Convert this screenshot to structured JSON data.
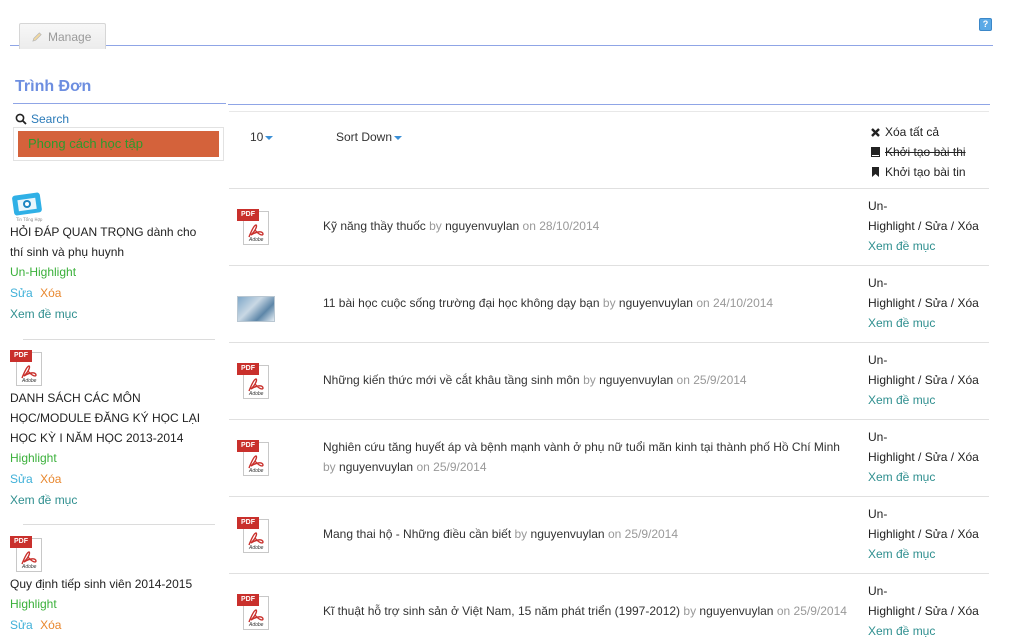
{
  "topbar": {
    "manage_label": "Manage",
    "help_label": "?"
  },
  "sidebar": {
    "title": "Trình Đơn",
    "search_label": "Search",
    "search_value": "Phong cách học tập",
    "items": [
      {
        "title": "HỎI ĐÁP QUAN TRỌNG dành cho thí sinh và phụ huynh",
        "highlight": "Un-Highlight",
        "edit": "Sửa",
        "delete": "Xóa",
        "view": "Xem đề mục",
        "icon": "tv-icon"
      },
      {
        "title": "DANH SÁCH CÁC MÔN HỌC/MODULE ĐĂNG KÝ HỌC LẠI HỌC KỲ I NĂM HỌC 2013-2014",
        "highlight": "Highlight",
        "edit": "Sửa",
        "delete": "Xóa",
        "view": "Xem đề mục",
        "icon": "pdf-icon"
      },
      {
        "title": "Quy định tiếp sinh viên 2014-2015",
        "highlight": "Highlight",
        "edit": "Sửa",
        "delete": "Xóa",
        "icon": "pdf-icon"
      }
    ]
  },
  "toolbar": {
    "page_size": "10",
    "sort": "Sort Down",
    "delete_all": "Xóa tất cả",
    "create_exam": "Khởi tạo bài thi",
    "create_news": "Khởi tạo bài tin"
  },
  "rows": [
    {
      "title": "Kỹ năng thầy thuốc",
      "by": "by",
      "author": "nguyenvuylan",
      "on": "on",
      "date": "28/10/2014",
      "icon": "pdf-icon"
    },
    {
      "title": "11 bài học cuộc sống trường đại học không dạy bạn",
      "by": "by",
      "author": "nguyenvuylan",
      "on": "on",
      "date": "24/10/2014",
      "icon": "photo"
    },
    {
      "title": "Những kiến thức mới về cắt khâu tầng sinh môn",
      "by": "by",
      "author": "nguyenvuylan",
      "on": "on",
      "date": "25/9/2014",
      "icon": "pdf-icon"
    },
    {
      "title": "Nghiên cứu tăng huyết áp và bệnh mạnh vành ở phụ nữ tuổi mãn kinh tại thành phố Hồ Chí Minh",
      "by": "by",
      "author": "nguyenvuylan",
      "on": "on",
      "date": "25/9/2014",
      "icon": "pdf-icon"
    },
    {
      "title": "Mang thai hộ - Những điều cần biết",
      "by": "by",
      "author": "nguyenvuylan",
      "on": "on",
      "date": "25/9/2014",
      "icon": "pdf-icon"
    },
    {
      "title": "Kĩ thuật hỗ trợ sinh sản ở Việt Nam, 15 năm phát triển (1997-2012)",
      "by": "by",
      "author": "nguyenvuylan",
      "on": "on",
      "date": "25/9/2014",
      "icon": "pdf-icon"
    }
  ],
  "row_ops": {
    "un": "Un-",
    "highlight": "Highlight",
    "sep": " / ",
    "edit": "Sửa",
    "delete": "Xóa",
    "view": "Xem đề mục"
  },
  "colors": {
    "accent_blue": "#6d8ee0",
    "search_bg": "#d4623b",
    "green": "#3ab03a",
    "teal": "#2f8f8f",
    "orange": "#e8872e",
    "pdf_red": "#c9302c"
  }
}
